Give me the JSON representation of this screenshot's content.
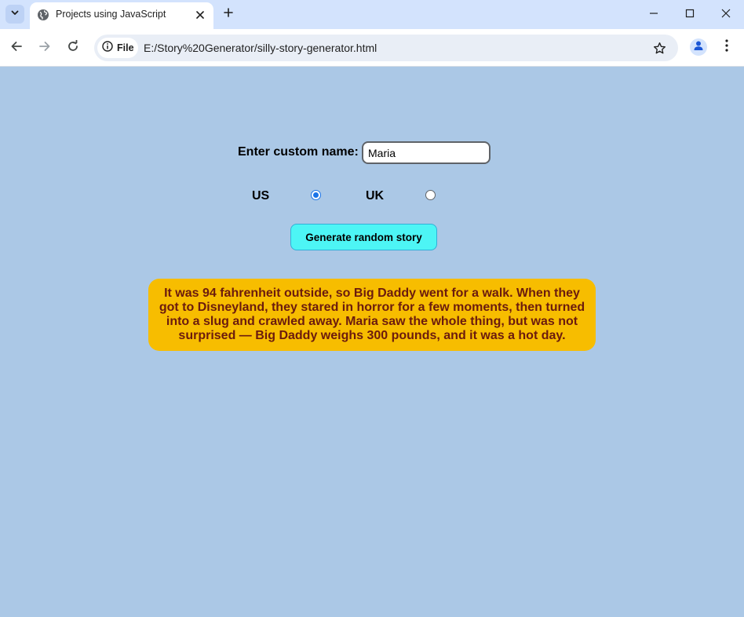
{
  "browser": {
    "tab": {
      "title": "Projects using JavaScript",
      "favicon": "globe-icon"
    },
    "omnibox": {
      "site_chip_label": "File",
      "url": "E:/Story%20Generator/silly-story-generator.html"
    },
    "icons": {
      "tab_list": "chevron-down-icon",
      "new_tab": "plus-icon",
      "minimize": "minimize-icon",
      "maximize": "maximize-icon",
      "close": "close-icon",
      "back": "back-arrow-icon",
      "forward": "forward-arrow-icon",
      "reload": "reload-icon",
      "info": "info-icon",
      "bookmark": "star-icon",
      "profile": "person-icon",
      "menu": "kebab-menu-icon"
    }
  },
  "page": {
    "name_label": "Enter custom name:",
    "name_value": "Maria",
    "region": {
      "us_label": "US",
      "uk_label": "UK",
      "selected": "US"
    },
    "generate_button": "Generate random story",
    "story": "It was 94 fahrenheit outside, so Big Daddy went for a walk. When they got to Disneyland, they stared in horror for a few moments, then turned into a slug and crawled away. Maria saw the whole thing, but was not surprised — Big Daddy weighs 300 pounds, and it was a hot day."
  },
  "colors": {
    "page_background": "#abc8e6",
    "story_background": "#f7bd00",
    "story_text": "#6b1b0e",
    "button_background": "#4df5f5",
    "radio_accent": "#1a73e8"
  }
}
